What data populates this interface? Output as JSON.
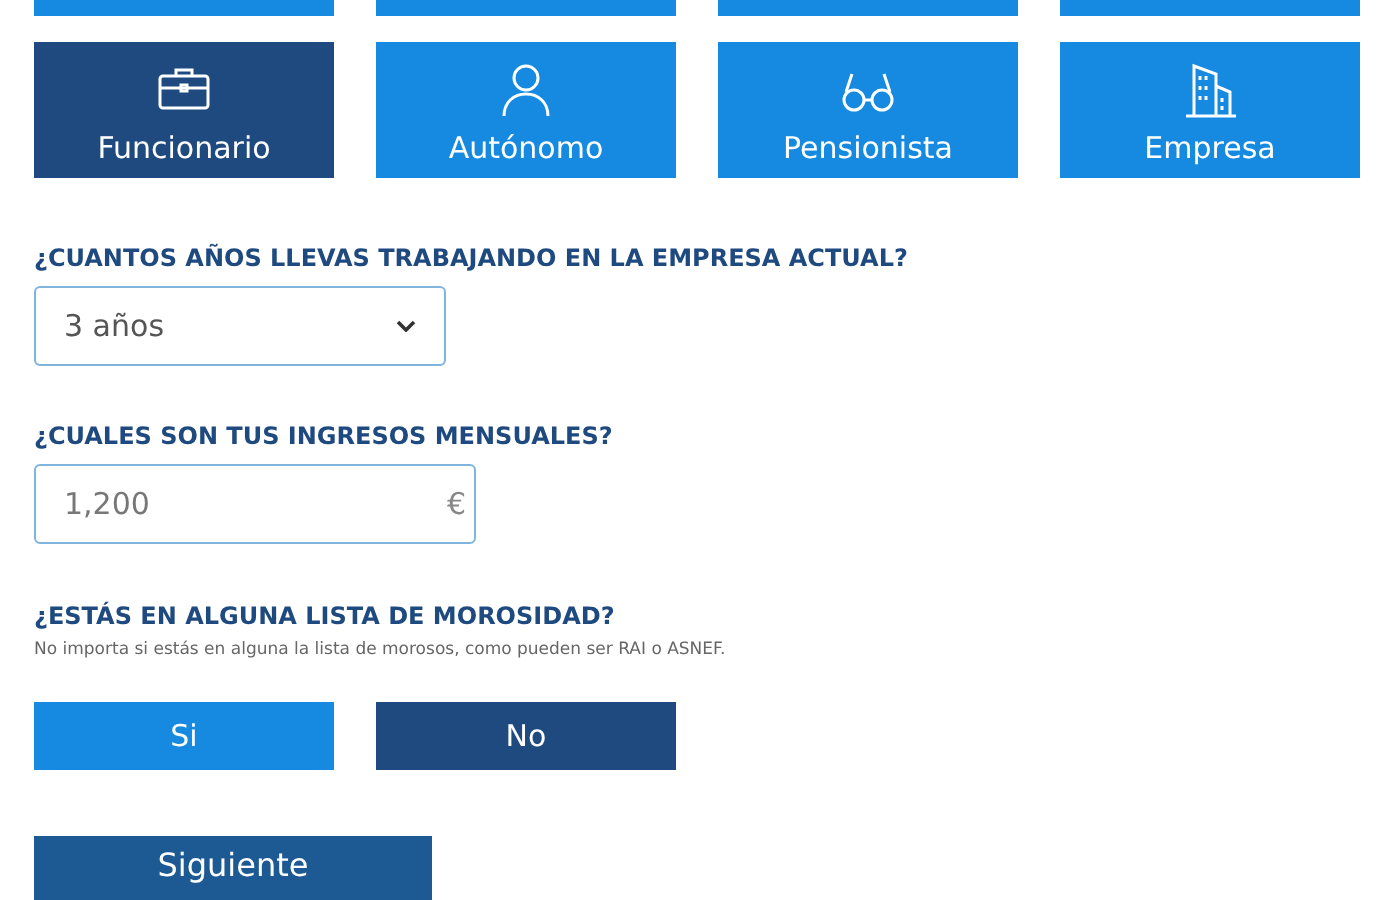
{
  "partial_tiles": [
    {
      "selected": false
    },
    {
      "selected": false
    },
    {
      "selected": false
    },
    {
      "selected": false
    }
  ],
  "profile_tiles": [
    {
      "label": "Funcionario",
      "kind": "briefcase",
      "selected": true
    },
    {
      "label": "Autónomo",
      "kind": "person",
      "selected": false
    },
    {
      "label": "Pensionista",
      "kind": "glasses",
      "selected": false
    },
    {
      "label": "Empresa",
      "kind": "building",
      "selected": false
    }
  ],
  "years_question": {
    "label": "¿CUANTOS AÑOS LLEVAS TRABAJANDO EN LA EMPRESA ACTUAL?",
    "value": "3 años"
  },
  "income_question": {
    "label": "¿CUALES SON TUS INGRESOS MENSUALES?",
    "value": "1,200",
    "unit": "€"
  },
  "debt_question": {
    "label": "¿ESTÁS EN ALGUNA LISTA DE MOROSIDAD?",
    "hint": "No importa si estás en alguna la lista de morosos, como pueden ser RAI o ASNEF.",
    "options": [
      {
        "label": "Si",
        "selected": false
      },
      {
        "label": "No",
        "selected": true
      }
    ]
  },
  "next_button": "Siguiente"
}
